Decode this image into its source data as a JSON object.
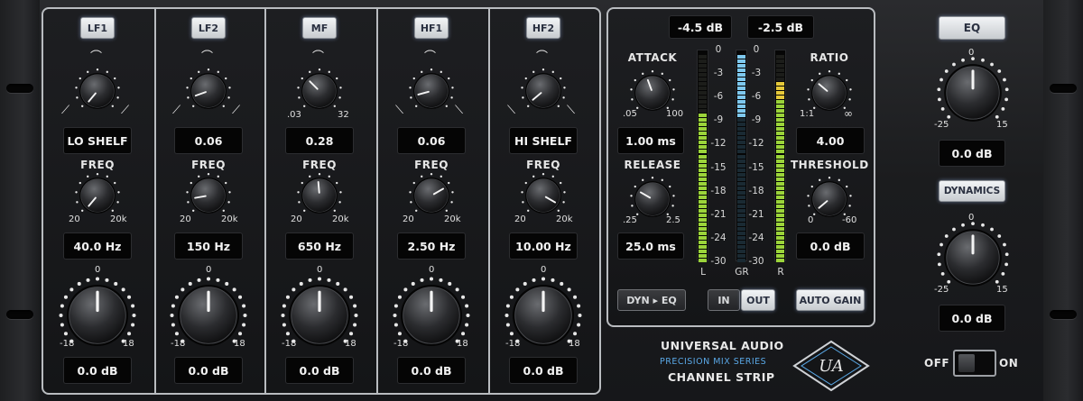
{
  "eq_bands": [
    {
      "name": "LF1",
      "top_value": "LO SHELF",
      "freq_label": "FREQ",
      "freq_min": "20",
      "freq_max": "20k",
      "freq_value": "40.0 Hz",
      "gain_min": "-18",
      "gain_max": "18",
      "gain_zero": "0",
      "gain_value": "0.0 dB"
    },
    {
      "name": "LF2",
      "top_value": "0.06",
      "freq_label": "FREQ",
      "freq_min": "20",
      "freq_max": "20k",
      "freq_value": "150 Hz",
      "gain_min": "-18",
      "gain_max": "18",
      "gain_zero": "0",
      "gain_value": "0.0 dB"
    },
    {
      "name": "MF",
      "top_value": "0.28",
      "q_min": ".03",
      "q_max": "32",
      "freq_label": "FREQ",
      "freq_min": "20",
      "freq_max": "20k",
      "freq_value": "650 Hz",
      "gain_min": "-18",
      "gain_max": "18",
      "gain_zero": "0",
      "gain_value": "0.0 dB"
    },
    {
      "name": "HF1",
      "top_value": "0.06",
      "freq_label": "FREQ",
      "freq_min": "20",
      "freq_max": "20k",
      "freq_value": "2.50 Hz",
      "gain_min": "-18",
      "gain_max": "18",
      "gain_zero": "0",
      "gain_value": "0.0 dB"
    },
    {
      "name": "HF2",
      "top_value": "HI SHELF",
      "freq_label": "FREQ",
      "freq_min": "20",
      "freq_max": "20k",
      "freq_value": "10.00 Hz",
      "gain_min": "-18",
      "gain_max": "18",
      "gain_zero": "0",
      "gain_value": "0.0 dB"
    }
  ],
  "dynamics": {
    "attack": {
      "label": "ATTACK",
      "min": ".05",
      "max": "100",
      "value": "1.00 ms"
    },
    "release": {
      "label": "RELEASE",
      "min": ".25",
      "max": "2.5",
      "value": "25.0 ms"
    },
    "ratio": {
      "label": "RATIO",
      "min": "1:1",
      "max": "∞",
      "value": "4.00"
    },
    "threshold": {
      "label": "THRESHOLD",
      "min": "0",
      "max": "-60",
      "value": "0.0 dB"
    },
    "meter_left_readout": "-4.5 dB",
    "meter_right_readout": "-2.5 dB",
    "meter_scale": [
      "0",
      "-3",
      "-6",
      "-9",
      "-12",
      "-15",
      "-18",
      "-21",
      "-24",
      "-30"
    ],
    "meter_labels": {
      "left": "L",
      "gr": "GR",
      "right": "R"
    },
    "meter_levels": {
      "left": 0.72,
      "gr": 0.3,
      "right": 0.86
    },
    "dyn_eq_button": "DYN ▸ EQ",
    "in_label": "IN",
    "out_label": "OUT",
    "auto_gain_label": "AUTO GAIN"
  },
  "output": {
    "eq_button": "EQ",
    "eq_gain": {
      "min": "-25",
      "max": "15",
      "zero": "0",
      "value": "0.0 dB"
    },
    "dynamics_button": "DYNAMICS",
    "dyn_gain": {
      "min": "-25",
      "max": "15",
      "zero": "0",
      "value": "0.0 dB"
    },
    "off_label": "OFF",
    "on_label": "ON"
  },
  "branding": {
    "maker": "UNIVERSAL AUDIO",
    "series": "PRECISION MIX SERIES",
    "product": "CHANNEL STRIP"
  },
  "colors": {
    "meter_green": "#9bd43a",
    "meter_yellow": "#e6c93a",
    "meter_red": "#e2452f",
    "meter_gr": "#7ec8ee",
    "accent_blue": "#5aa8e6"
  }
}
